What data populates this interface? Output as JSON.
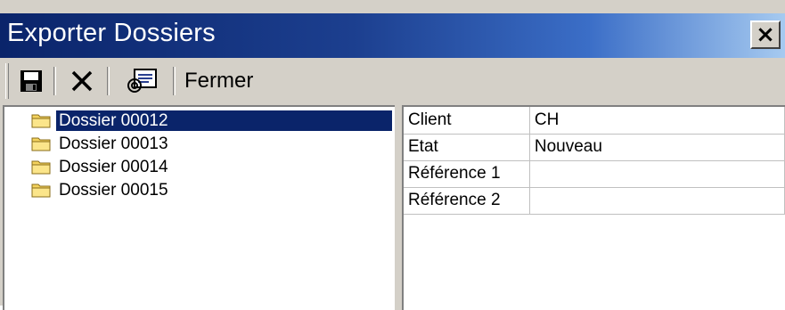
{
  "window": {
    "title": "Exporter Dossiers",
    "close_glyph": "×"
  },
  "toolbar": {
    "save_icon": "save-icon",
    "delete_icon": "delete-icon",
    "export_icon": "export-icon",
    "close_label": "Fermer"
  },
  "tree": {
    "items": [
      {
        "label": "Dossier 00012",
        "selected": true
      },
      {
        "label": "Dossier 00013",
        "selected": false
      },
      {
        "label": "Dossier 00014",
        "selected": false
      },
      {
        "label": "Dossier 00015",
        "selected": false
      }
    ]
  },
  "properties": {
    "rows": [
      {
        "key": "Client",
        "value": "CH"
      },
      {
        "key": "Etat",
        "value": "Nouveau"
      },
      {
        "key": "Référence 1",
        "value": ""
      },
      {
        "key": "Référence 2",
        "value": ""
      }
    ]
  },
  "colors": {
    "title_bar_start": "#0a246a",
    "title_bar_end": "#a6caf0",
    "selection": "#0a246a",
    "face": "#d4d0c8",
    "folder": "#f4d35e"
  }
}
